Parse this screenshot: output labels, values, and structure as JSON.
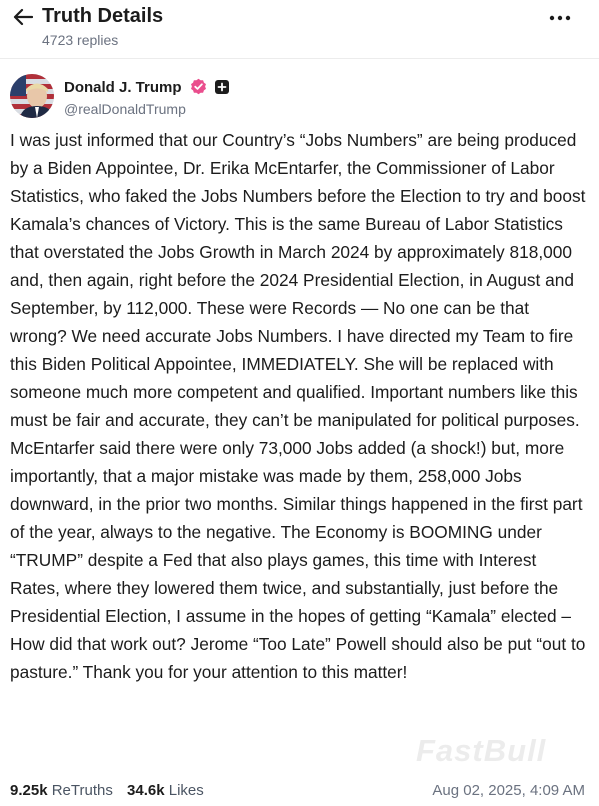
{
  "header": {
    "title": "Truth Details",
    "replies": "4723 replies",
    "back_icon": "arrow-left-icon",
    "more_icon": "more-horizontal-icon"
  },
  "author": {
    "name": "Donald J. Trump",
    "handle": "@realDonaldTrump",
    "verified_color": "#ea4e8d",
    "avatar_icon": "avatar-image"
  },
  "post": {
    "body": "I was just informed that our Country’s “Jobs Numbers” are being produced by a Biden Appointee, Dr. Erika McEntarfer, the Commissioner of Labor Statistics, who faked the Jobs Numbers before the Election to try and boost Kamala’s chances of Victory. This is the same Bureau of Labor Statistics that overstated the Jobs Growth in March 2024 by approximately 818,000 and, then again, right before the 2024 Presidential Election, in August and September, by 112,000. These were Records — No one can be that wrong? We need accurate Jobs Numbers. I have directed my Team to fire this Biden Political Appointee, IMMEDIATELY. She will be replaced with someone much more competent and qualified. Important numbers like this must be fair and accurate, they can’t be manipulated for political purposes. McEntarfer said there were only 73,000 Jobs added (a shock!) but, more importantly, that a major mistake was made by them, 258,000 Jobs downward, in the prior two months. Similar things happened in the first part of the year, always to the negative. The Economy is BOOMING under “TRUMP” despite a Fed that also plays games, this time with Interest Rates, where they lowered them twice, and substantially, just before the Presidential Election, I assume in the hopes of getting “Kamala” elected – How did that work out? Jerome “Too Late” Powell should also be put “out to pasture.” Thank you for your attention to this matter!"
  },
  "stats": {
    "retruths_count": "9.25k",
    "retruths_label": "ReTruths",
    "likes_count": "34.6k",
    "likes_label": "Likes",
    "timestamp": "Aug 02, 2025, 4:09 AM"
  },
  "watermark": "FastBull"
}
